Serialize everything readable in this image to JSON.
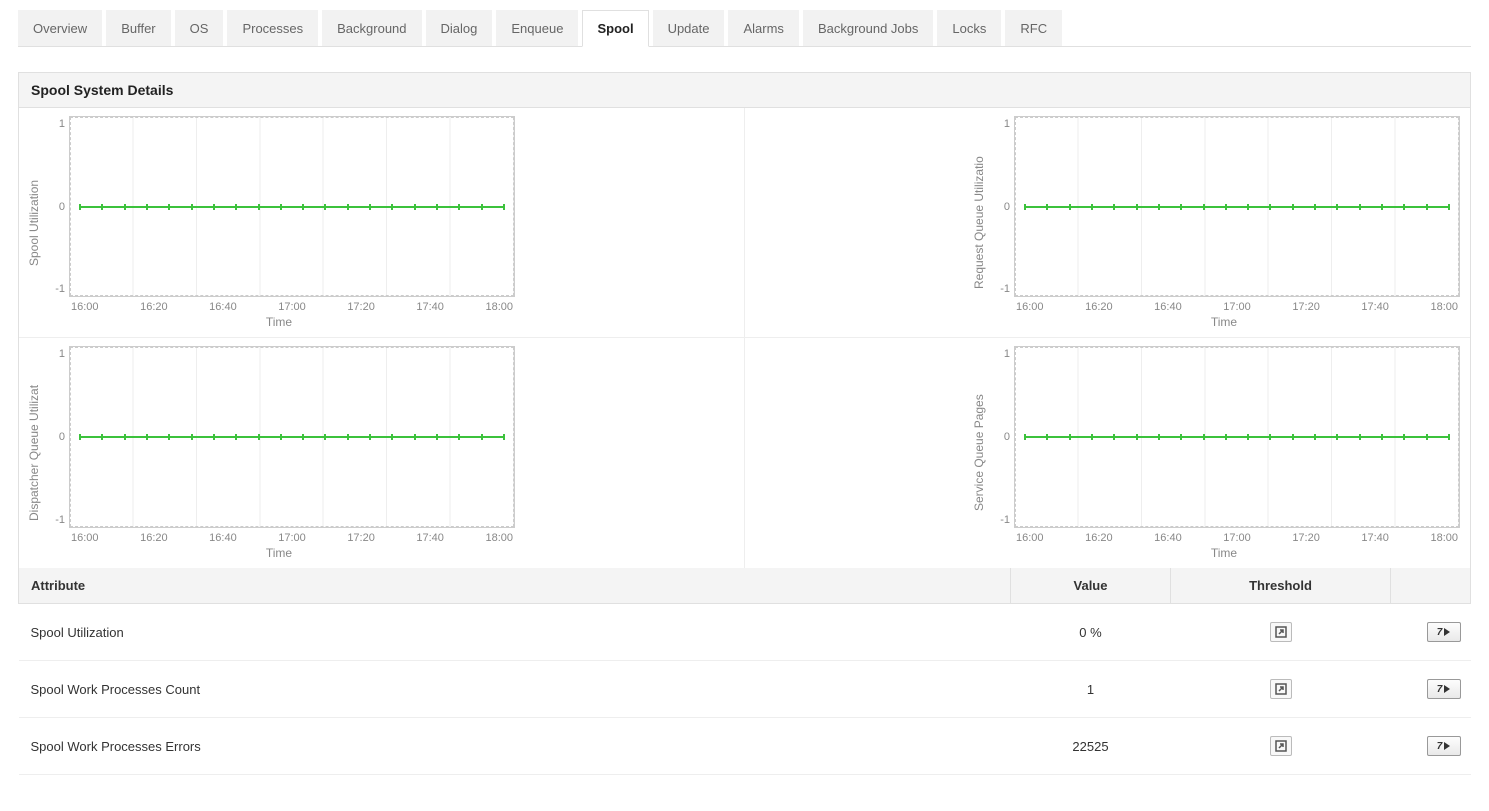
{
  "tabs": [
    {
      "label": "Overview",
      "active": false
    },
    {
      "label": "Buffer",
      "active": false
    },
    {
      "label": "OS",
      "active": false
    },
    {
      "label": "Processes",
      "active": false
    },
    {
      "label": "Background",
      "active": false
    },
    {
      "label": "Dialog",
      "active": false
    },
    {
      "label": "Enqueue",
      "active": false
    },
    {
      "label": "Spool",
      "active": true
    },
    {
      "label": "Update",
      "active": false
    },
    {
      "label": "Alarms",
      "active": false
    },
    {
      "label": "Background Jobs",
      "active": false
    },
    {
      "label": "Locks",
      "active": false
    },
    {
      "label": "RFC",
      "active": false
    }
  ],
  "panel_title": "Spool System Details",
  "chart_data": [
    {
      "type": "line",
      "title": "",
      "ylabel": "Spool Utilization",
      "xlabel": "Time",
      "ylim": [
        -1,
        1
      ],
      "yticks": [
        "1",
        "0",
        "-1"
      ],
      "categories": [
        "16:00",
        "16:20",
        "16:40",
        "17:00",
        "17:20",
        "17:40",
        "18:00"
      ],
      "values": [
        0,
        0,
        0,
        0,
        0,
        0,
        0
      ],
      "color": "#3cc23c"
    },
    {
      "type": "line",
      "title": "",
      "ylabel": "Request Queue Utilizatio",
      "xlabel": "Time",
      "ylim": [
        -1,
        1
      ],
      "yticks": [
        "1",
        "0",
        "-1"
      ],
      "categories": [
        "16:00",
        "16:20",
        "16:40",
        "17:00",
        "17:20",
        "17:40",
        "18:00"
      ],
      "values": [
        0,
        0,
        0,
        0,
        0,
        0,
        0
      ],
      "color": "#3cc23c"
    },
    {
      "type": "line",
      "title": "",
      "ylabel": "Dispatcher Queue Utilizat",
      "xlabel": "Time",
      "ylim": [
        -1,
        1
      ],
      "yticks": [
        "1",
        "0",
        "-1"
      ],
      "categories": [
        "16:00",
        "16:20",
        "16:40",
        "17:00",
        "17:20",
        "17:40",
        "18:00"
      ],
      "values": [
        0,
        0,
        0,
        0,
        0,
        0,
        0
      ],
      "color": "#3cc23c"
    },
    {
      "type": "line",
      "title": "",
      "ylabel": "Service Queue Pages",
      "xlabel": "Time",
      "ylim": [
        -1,
        1
      ],
      "yticks": [
        "1",
        "0",
        "-1"
      ],
      "categories": [
        "16:00",
        "16:20",
        "16:40",
        "17:00",
        "17:20",
        "17:40",
        "18:00"
      ],
      "values": [
        0,
        0,
        0,
        0,
        0,
        0,
        0
      ],
      "color": "#3cc23c"
    }
  ],
  "table": {
    "headers": {
      "attribute": "Attribute",
      "value": "Value",
      "threshold": "Threshold"
    },
    "rows": [
      {
        "attribute": "Spool Utilization",
        "value": "0 %"
      },
      {
        "attribute": "Spool Work Processes Count",
        "value": "1"
      },
      {
        "attribute": "Spool Work Processes Errors",
        "value": "22525"
      }
    ],
    "history_label": "7"
  }
}
